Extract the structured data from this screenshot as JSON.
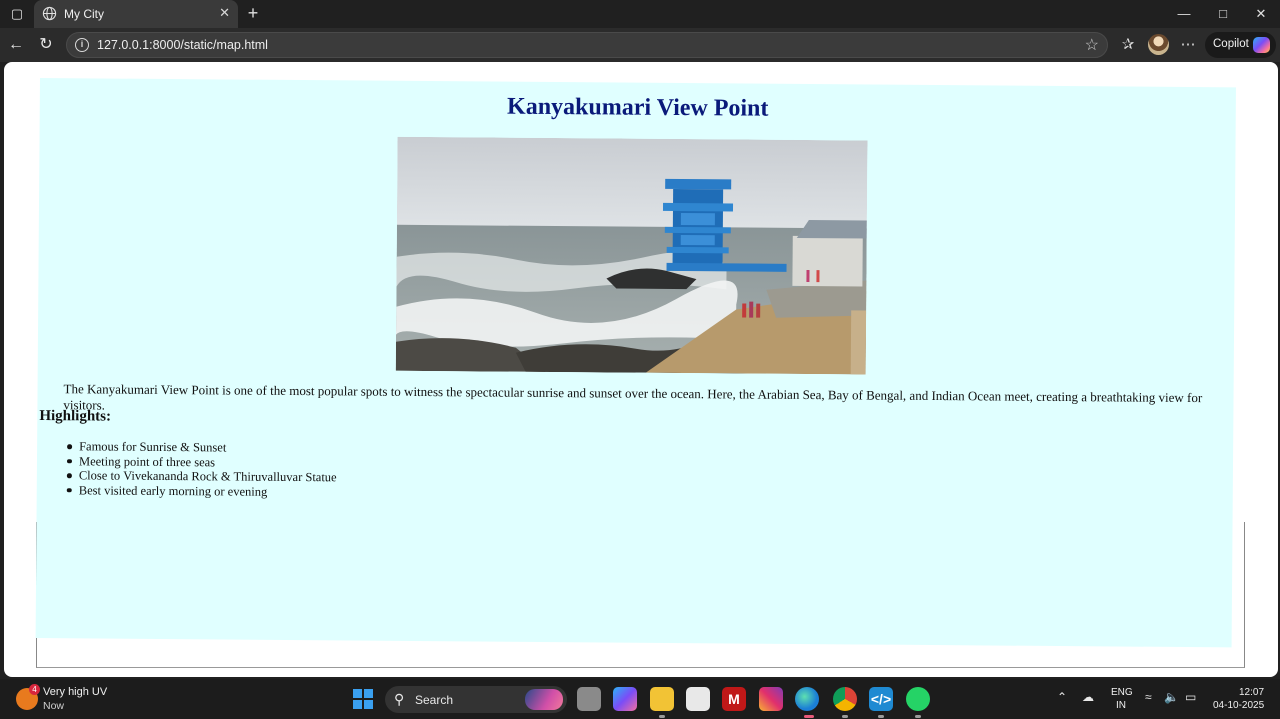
{
  "browser": {
    "tab_title": "My City",
    "url": "127.0.0.1:8000/static/map.html",
    "copilot_label": "Copilot"
  },
  "page": {
    "heading": "Kanyakumari View Point",
    "description": "The Kanyakumari View Point is one of the most popular spots to witness the spectacular sunrise and sunset over the ocean. Here, the Arabian Sea, Bay of Bengal, and Indian Ocean meet, creating a breathtaking view for visitors.",
    "highlights_title": "Highlights:",
    "highlights": [
      "Famous for Sunrise & Sunset",
      "Meeting point of three seas",
      "Close to Vivekananda Rock & Thiruvalluvar Statue",
      "Best visited early morning or evening"
    ],
    "background_color": "#e0ffff",
    "heading_color": "#0a1a7a"
  },
  "taskbar": {
    "weather_text": "Very high UV",
    "weather_sub": "Now",
    "weather_badge": "4",
    "search_label": "Search",
    "language_line1": "ENG",
    "language_line2": "IN",
    "time": "12:07",
    "date": "04-10-2025"
  }
}
